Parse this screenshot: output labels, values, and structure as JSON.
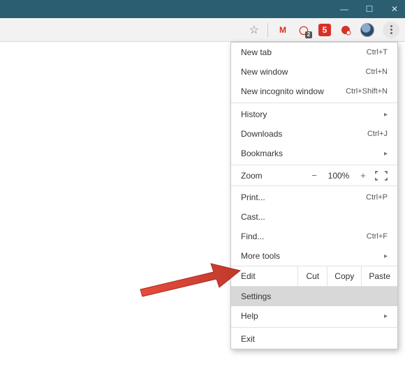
{
  "window": {
    "minimize_glyph": "—",
    "maximize_glyph": "☐",
    "close_glyph": "✕"
  },
  "toolbar": {
    "star_glyph": "☆",
    "gmail_glyph": "M",
    "opera_glyph": "◯",
    "s5_label": "5",
    "opera_badge": "2",
    "kebab_name": "menu-icon"
  },
  "menu": {
    "new_tab": {
      "label": "New tab",
      "shortcut": "Ctrl+T"
    },
    "new_window": {
      "label": "New window",
      "shortcut": "Ctrl+N"
    },
    "new_incognito": {
      "label": "New incognito window",
      "shortcut": "Ctrl+Shift+N"
    },
    "history": {
      "label": "History"
    },
    "downloads": {
      "label": "Downloads",
      "shortcut": "Ctrl+J"
    },
    "bookmarks": {
      "label": "Bookmarks"
    },
    "zoom": {
      "label": "Zoom",
      "minus": "−",
      "value": "100%",
      "plus": "+"
    },
    "print": {
      "label": "Print...",
      "shortcut": "Ctrl+P"
    },
    "cast": {
      "label": "Cast..."
    },
    "find": {
      "label": "Find...",
      "shortcut": "Ctrl+F"
    },
    "more_tools": {
      "label": "More tools"
    },
    "edit": {
      "label": "Edit",
      "cut": "Cut",
      "copy": "Copy",
      "paste": "Paste"
    },
    "settings": {
      "label": "Settings"
    },
    "help": {
      "label": "Help"
    },
    "exit": {
      "label": "Exit"
    },
    "chevron": "▸"
  }
}
